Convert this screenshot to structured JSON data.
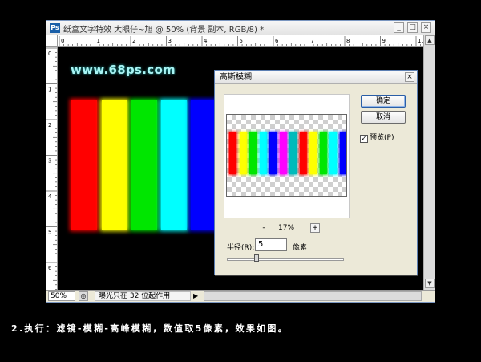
{
  "window": {
    "title": "纸盒文字特效 大眼仔~旭 @ 50% (背景 副本, RGB/8) *",
    "minimize": "_",
    "maximize": "□",
    "close": "×",
    "ruler_h_labels": [
      "0",
      "1",
      "2",
      "3",
      "4",
      "5",
      "6",
      "7",
      "8",
      "9",
      "10"
    ],
    "ruler_v_labels": [
      "0",
      "1",
      "2",
      "3",
      "4",
      "5",
      "6"
    ]
  },
  "canvas": {
    "watermark": "www.68ps.com",
    "bar_colors": [
      "#ff0000",
      "#ffff00",
      "#00e600",
      "#00ffff",
      "#0000ff"
    ]
  },
  "status": {
    "zoom": "50%",
    "message": "曝光只在 32 位起作用",
    "arrow": "▶"
  },
  "dialog": {
    "title": "高斯模糊",
    "close": "×",
    "ok_label": "确定",
    "cancel_label": "取消",
    "preview_label": "预览(P)",
    "preview_checked": "✓",
    "zoom_minus": "-",
    "zoom_level": "17%",
    "zoom_plus": "+",
    "radius_label": "半径(R):",
    "radius_value": "5",
    "radius_unit": "像素",
    "preview_bar_colors": [
      "#ff0000",
      "#ffff00",
      "#00e600",
      "#00ffff",
      "#0000ff",
      "#ff00ff",
      "#00bbbb"
    ],
    "radius_slider_fraction": 0.25
  },
  "caption": "2.执行：滤镜-模糊-高峰模糊，数值取5像素，效果如图。"
}
